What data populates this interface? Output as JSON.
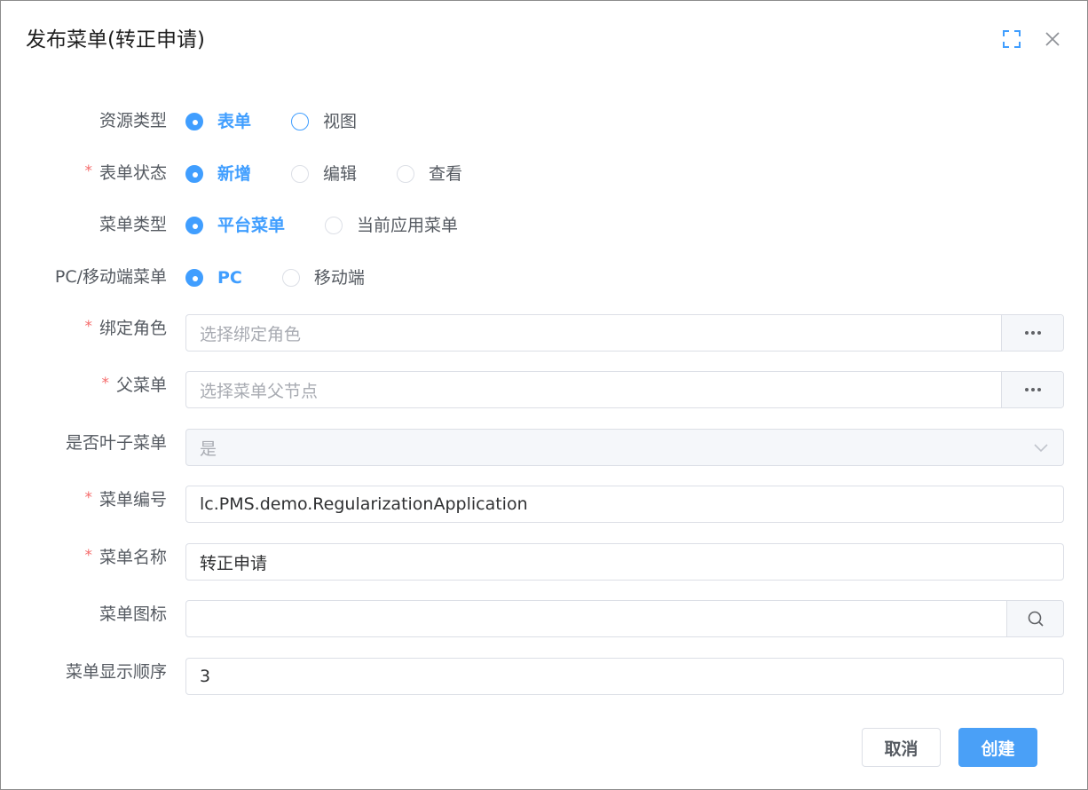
{
  "dialog": {
    "title": "发布菜单(转正申请)",
    "icons": {
      "fullscreen": "fullscreen-icon",
      "close": "close-icon"
    }
  },
  "form": {
    "resource_type": {
      "label": "资源类型",
      "required": false,
      "options": [
        "表单",
        "视图"
      ],
      "selected": "表单"
    },
    "form_state": {
      "label": "表单状态",
      "required": true,
      "options": [
        "新增",
        "编辑",
        "查看"
      ],
      "selected": "新增"
    },
    "menu_type": {
      "label": "菜单类型",
      "required": false,
      "options": [
        "平台菜单",
        "当前应用菜单"
      ],
      "selected": "平台菜单"
    },
    "platform": {
      "label": "PC/移动端菜单",
      "required": false,
      "options": [
        "PC",
        "移动端"
      ],
      "selected": "PC"
    },
    "bind_role": {
      "label": "绑定角色",
      "required": true,
      "value": "",
      "placeholder": "选择绑定角色"
    },
    "parent_menu": {
      "label": "父菜单",
      "required": true,
      "value": "",
      "placeholder": "选择菜单父节点"
    },
    "is_leaf": {
      "label": "是否叶子菜单",
      "required": false,
      "value": "是",
      "disabled": true
    },
    "menu_code": {
      "label": "菜单编号",
      "required": true,
      "value": "lc.PMS.demo.RegularizationApplication"
    },
    "menu_name": {
      "label": "菜单名称",
      "required": true,
      "value": "转正申请"
    },
    "menu_icon": {
      "label": "菜单图标",
      "required": false,
      "value": ""
    },
    "menu_order": {
      "label": "菜单显示顺序",
      "required": false,
      "value": "3"
    },
    "required_mark": "*"
  },
  "footer": {
    "cancel_label": "取消",
    "create_label": "创建"
  },
  "colors": {
    "primary": "#409eff",
    "required": "#f56c6c",
    "border": "#dcdfe6"
  }
}
